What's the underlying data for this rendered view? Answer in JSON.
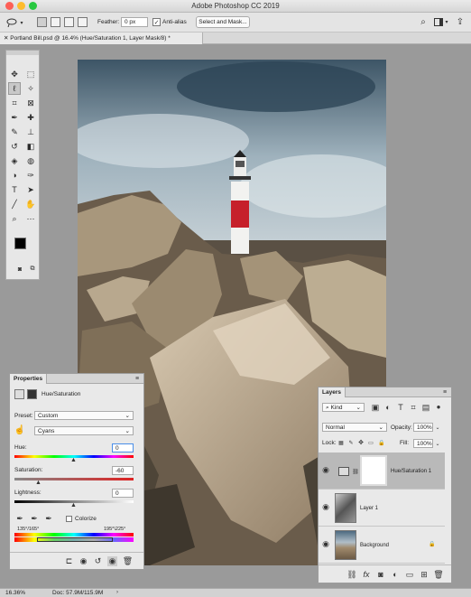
{
  "app": {
    "title": "Adobe Photoshop CC 2019"
  },
  "options": {
    "feather_label": "Feather:",
    "feather_value": "0 px",
    "antialias_label": "Anti-alias",
    "antialias_checked": true,
    "select_mask_label": "Select and Mask..."
  },
  "document": {
    "tab_title": "Portland Bill.psd @ 16.4% (Hue/Saturation 1, Layer Mask/8) *"
  },
  "tools": {
    "icons": [
      "move-icon",
      "marquee-icon",
      "lasso-icon",
      "magic-wand-icon",
      "crop-icon",
      "frame-icon",
      "eyedropper-icon",
      "healing-brush-icon",
      "brush-icon",
      "clone-stamp-icon",
      "history-brush-icon",
      "eraser-icon",
      "paint-bucket-icon",
      "blur-icon",
      "dodge-icon",
      "pen-icon",
      "type-icon",
      "path-selection-icon",
      "line-icon",
      "hand-icon",
      "zoom-icon",
      "more-tools-icon"
    ],
    "foreground": "#000000",
    "background": "#ffffff"
  },
  "properties": {
    "tab": "Properties",
    "adjustment": "Hue/Saturation",
    "preset_label": "Preset:",
    "preset_value": "Custom",
    "channel_value": "Cyans",
    "hue_label": "Hue:",
    "hue_value": "0",
    "saturation_label": "Saturation:",
    "saturation_value": "-60",
    "lightness_label": "Lightness:",
    "lightness_value": "0",
    "colorize_label": "Colorize",
    "range_left": "135°/165°",
    "range_right": "195°\\225°"
  },
  "layers": {
    "tab": "Layers",
    "kind_label": "Kind",
    "blend_mode": "Normal",
    "opacity_label": "Opacity:",
    "opacity_value": "100%",
    "lock_label": "Lock:",
    "fill_label": "Fill:",
    "fill_value": "100%",
    "items": [
      {
        "name": "Hue/Saturation 1",
        "selected": true
      },
      {
        "name": "Layer 1",
        "selected": false
      },
      {
        "name": "Background",
        "selected": false
      }
    ]
  },
  "status": {
    "zoom": "16.36%",
    "doc_info": "Doc: 57.9M/115.9M"
  }
}
